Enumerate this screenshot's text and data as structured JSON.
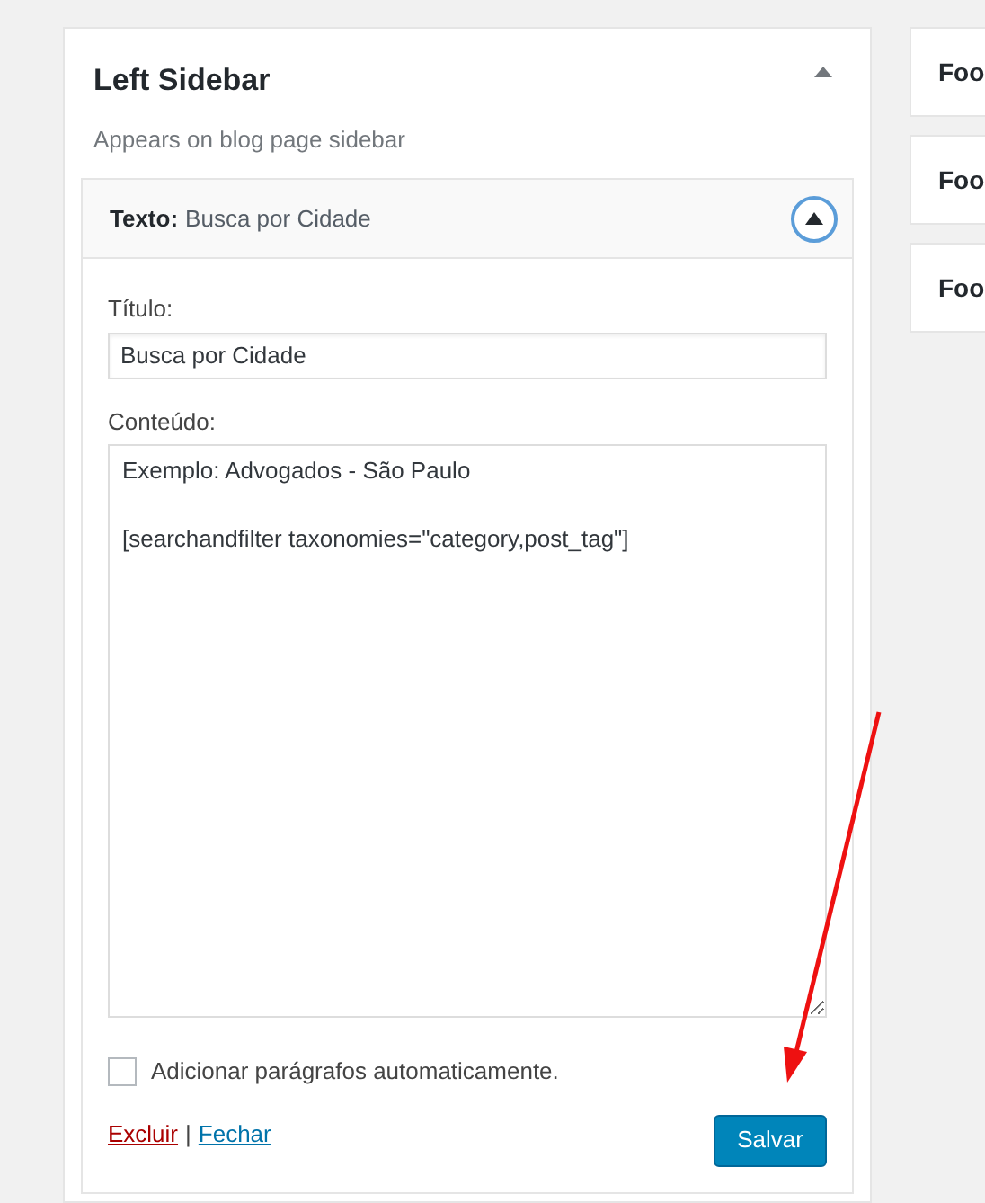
{
  "sidebar_area": {
    "title": "Left Sidebar",
    "description": "Appears on blog page sidebar",
    "expanded": true,
    "widget": {
      "type_label": "Texto:",
      "title": "Busca por Cidade",
      "expanded": true,
      "fields": [
        {
          "kind": "input",
          "label": "Título:",
          "value": "Busca por Cidade"
        },
        {
          "kind": "textarea",
          "label": "Conteúdo:",
          "value": "Exemplo: Advogados - São Paulo\n\n[searchandfilter taxonomies=\"category,post_tag\"]"
        }
      ],
      "auto_paragraphs": {
        "label": "Adicionar parágrafos automaticamente.",
        "checked": false
      },
      "links": [
        {
          "kind": "delete",
          "label": "Excluir"
        },
        {
          "kind": "close",
          "label": "Fechar"
        }
      ],
      "separator": "|",
      "save_button": "Salvar"
    }
  },
  "other_areas": [
    {
      "title": "Foo"
    },
    {
      "title": "Foo"
    },
    {
      "title": "Foo"
    }
  ]
}
